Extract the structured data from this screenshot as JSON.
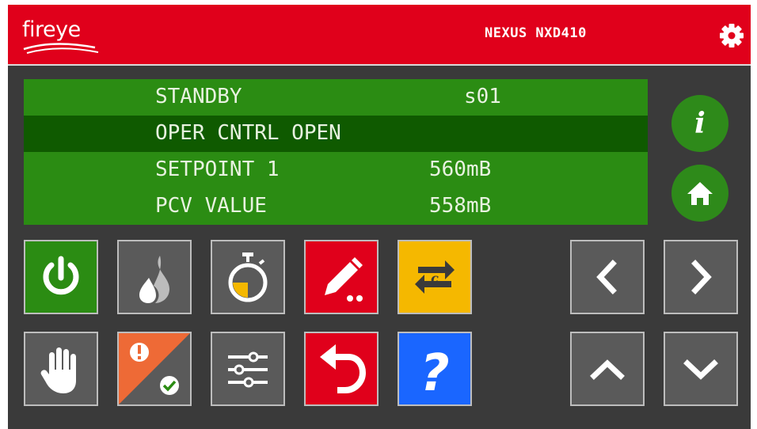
{
  "header": {
    "logo_text": "fireye",
    "model": "NEXUS NXD410",
    "settings_icon": "gear-icon"
  },
  "colors": {
    "header_red": "#e0001b",
    "lcd_green": "#2b8c13",
    "lcd_selected": "#0f5a00",
    "button_green": "#2e8a1a",
    "tile_gray": "#5a5a5a",
    "tile_red": "#e0001b",
    "tile_yellow": "#f5b800",
    "tile_blue": "#1a66ff",
    "tile_orange": "#ee6a36"
  },
  "display": {
    "rows": [
      {
        "label": "STANDBY",
        "value": "s01",
        "selected": false
      },
      {
        "label": "OPER CNTRL OPEN",
        "value": "",
        "selected": true
      },
      {
        "label": "SETPOINT 1",
        "value": "560mB",
        "selected": false
      },
      {
        "label": "PCV VALUE",
        "value": "558mB",
        "selected": false
      }
    ]
  },
  "side_buttons": [
    {
      "icon": "info-icon",
      "glyph": "i"
    },
    {
      "icon": "home-icon"
    }
  ],
  "function_buttons_row1": [
    "power-icon",
    "flame-icon",
    "timer-icon",
    "edit-icon",
    "cycle-c-icon"
  ],
  "function_buttons_row2": [
    "hand-icon",
    "alarm-ack-icon",
    "sliders-icon",
    "undo-icon",
    "help-icon"
  ],
  "help_glyph": "?",
  "cycle_glyph": "c",
  "nav_buttons": [
    "chevron-left-icon",
    "chevron-right-icon",
    "chevron-up-icon",
    "chevron-down-icon"
  ]
}
